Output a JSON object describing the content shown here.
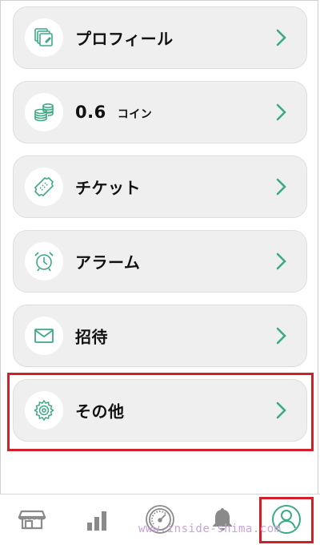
{
  "menu": {
    "items": [
      {
        "key": "profile",
        "label": "プロフィール",
        "icon": "profile-icon"
      },
      {
        "key": "coin",
        "amount": "0.6",
        "unit": "コイン",
        "icon": "coins-icon"
      },
      {
        "key": "ticket",
        "label": "チケット",
        "icon": "ticket-icon"
      },
      {
        "key": "alarm",
        "label": "アラーム",
        "icon": "alarm-clock-icon"
      },
      {
        "key": "invite",
        "label": "招待",
        "icon": "envelope-icon"
      },
      {
        "key": "other",
        "label": "その他",
        "icon": "gear-icon"
      }
    ]
  },
  "tabbar": {
    "tabs": [
      {
        "key": "shop",
        "icon": "store-icon"
      },
      {
        "key": "stats",
        "icon": "bar-chart-icon"
      },
      {
        "key": "meter",
        "icon": "speedometer-icon"
      },
      {
        "key": "notifications",
        "icon": "bell-icon"
      },
      {
        "key": "account",
        "icon": "user-icon",
        "active": true
      }
    ]
  },
  "watermark": "www.inside-shima.com",
  "colors": {
    "accent": "#3daa86",
    "card_bg": "#efefef",
    "highlight_box": "#d0202a",
    "tab_icon": "#8a8a8a"
  }
}
